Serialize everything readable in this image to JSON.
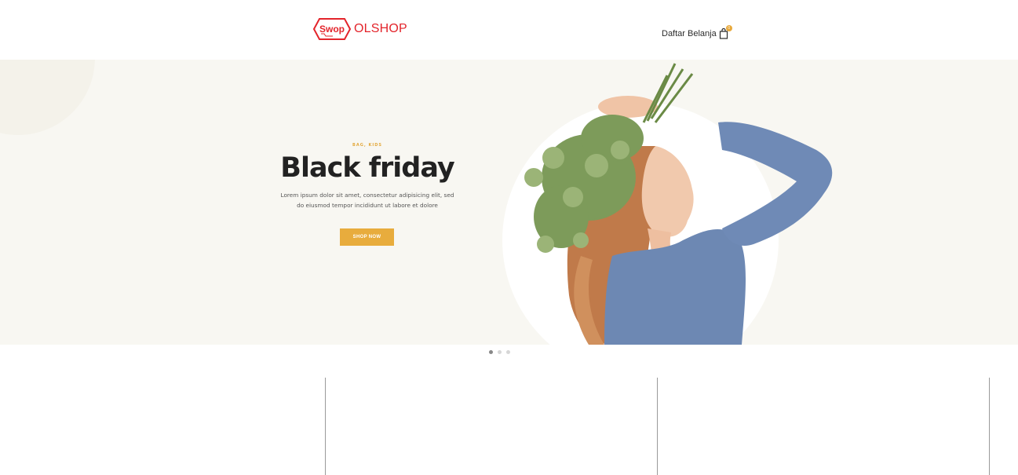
{
  "header": {
    "logo_badge_text": "Swop",
    "logo_text": "OLSHOP",
    "cart_label": "Daftar Belanja",
    "cart_icon": "shopping-bag-icon",
    "cart_count": "0"
  },
  "hero": {
    "tag": "BAG, KIDS",
    "title": "Black friday",
    "description": "Lorem ipsum dolor sit amet, consectetur adipisicing elit, sed do eiusmod tempor incididunt ut labore et dolore",
    "button_label": "SHOP NOW",
    "accent_color": "#e8ac3d"
  },
  "slider": {
    "slide_count": 3,
    "active_index": 0
  },
  "colors": {
    "brand": "#e3242b",
    "hero_bg": "#f8f7f2",
    "accent": "#e8ac3d"
  }
}
